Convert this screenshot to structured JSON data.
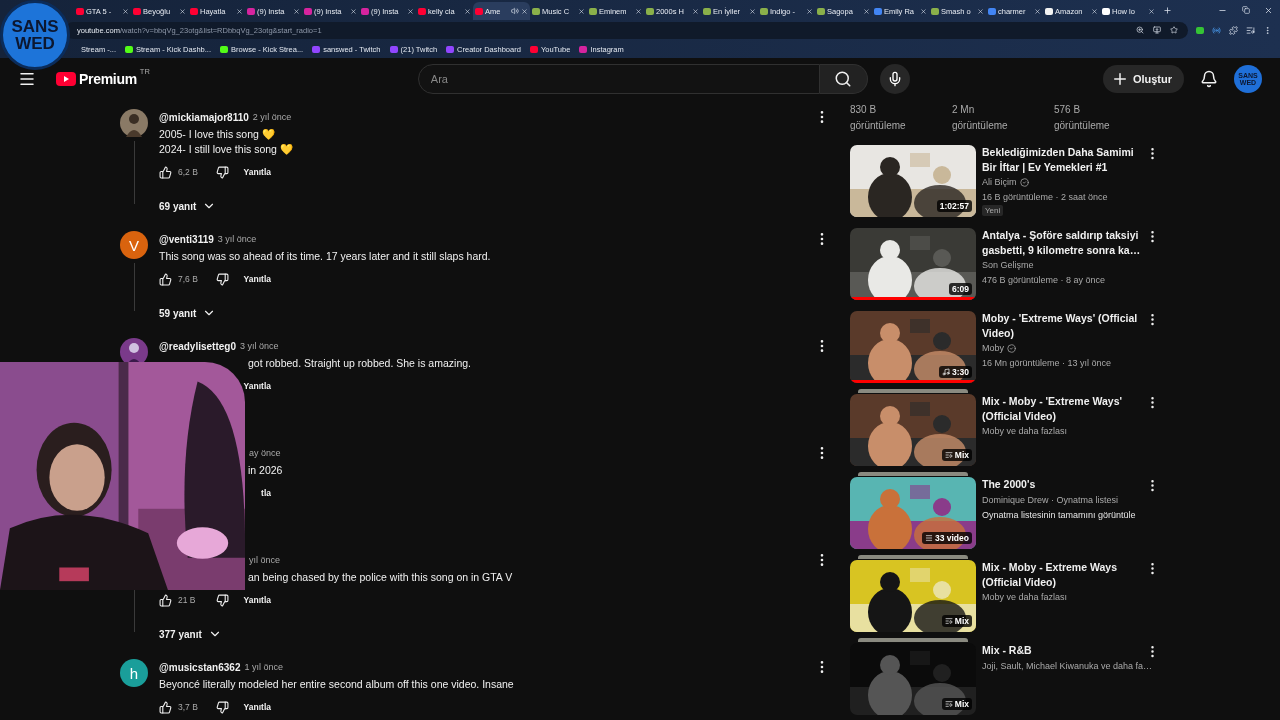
{
  "stream_logo": {
    "lines": [
      "SANS",
      "WED"
    ]
  },
  "browser": {
    "tabs": [
      {
        "title": "GTA 5 -",
        "kind": "play",
        "selected": false,
        "audio": false
      },
      {
        "title": "Beyoğlu",
        "kind": "play",
        "selected": false,
        "audio": false
      },
      {
        "title": "Hayatla",
        "kind": "play",
        "selected": false,
        "audio": false
      },
      {
        "title": "(9) Insta",
        "kind": "camera",
        "selected": false,
        "audio": false
      },
      {
        "title": "(9) Insta",
        "kind": "camera",
        "selected": false,
        "audio": false
      },
      {
        "title": "(9) Insta",
        "kind": "camera",
        "selected": false,
        "audio": false
      },
      {
        "title": "kelly cla",
        "kind": "play",
        "selected": false,
        "audio": false
      },
      {
        "title": "Ame",
        "kind": "play",
        "selected": true,
        "audio": true
      },
      {
        "title": "Music C",
        "kind": "site",
        "selected": false,
        "audio": false
      },
      {
        "title": "Eminem",
        "kind": "site",
        "selected": false,
        "audio": false
      },
      {
        "title": "2000s H",
        "kind": "site",
        "selected": false,
        "audio": false
      },
      {
        "title": "En İyiler",
        "kind": "site",
        "selected": false,
        "audio": false
      },
      {
        "title": "Indigo -",
        "kind": "site",
        "selected": false,
        "audio": false
      },
      {
        "title": "Sagopa",
        "kind": "site",
        "selected": false,
        "audio": false
      },
      {
        "title": "Emily Ra",
        "kind": "circle",
        "selected": false,
        "audio": false
      },
      {
        "title": "Smash o",
        "kind": "site",
        "selected": false,
        "audio": false
      },
      {
        "title": "charmer",
        "kind": "circle",
        "selected": false,
        "audio": false
      },
      {
        "title": "Amazon",
        "kind": "square",
        "selected": false,
        "audio": false
      },
      {
        "title": "How lo",
        "kind": "page",
        "selected": false,
        "audio": false
      }
    ],
    "url": {
      "host": "youtube.com",
      "path": "/watch?v=bbqVg_23otg&list=RDbbqVg_23otg&start_radio=1"
    },
    "bookmarks": [
      {
        "label": "Stream -...",
        "kind": "none"
      },
      {
        "label": "Stream - Kick Dashb...",
        "kind": "kick"
      },
      {
        "label": "Browse - Kick Strea...",
        "kind": "kick"
      },
      {
        "label": "sanswed - Twitch",
        "kind": "twitch"
      },
      {
        "label": "(21) Twitch",
        "kind": "twitch"
      },
      {
        "label": "Creator Dashboard",
        "kind": "twitch"
      },
      {
        "label": "YouTube",
        "kind": "play"
      },
      {
        "label": "Instagram",
        "kind": "camera"
      }
    ]
  },
  "header": {
    "logo": "Premium",
    "region": "TR",
    "search": {
      "placeholder": "Ara"
    },
    "create": "Oluştur",
    "avatar": [
      "SANS",
      "WED"
    ]
  },
  "comments": [
    {
      "kind": "full",
      "user": "@mickiamajor8110",
      "time": "2 yıl önce",
      "text": "2005- I love this song 💛\n2024- I still love this song 💛",
      "likes": "6,2 B",
      "reply": "Yanıtla",
      "replies": "69 yanıt"
    },
    {
      "kind": "full",
      "avatar": {
        "kind": "letter",
        "letter": "V",
        "color": "#d9630e"
      },
      "user": "@venti3119",
      "time": "3 yıl önce",
      "text": "This song was so ahead of its time. 17 years later and it still slaps hard.",
      "likes": "7,6 B",
      "reply": "Yanıtla",
      "replies": "59 yanıt"
    },
    {
      "kind": "partial",
      "user": "@readylisetteg0",
      "time": "3 yıl önce",
      "text": "got robbed. Straight up robbed. She is amazing.",
      "reply": "Yanıtla"
    },
    {
      "kind": "partial",
      "time": "ay önce",
      "text": "in 2026",
      "reply": "tla"
    },
    {
      "kind": "partial",
      "time": "yıl önce",
      "text": "an being  chased by the police with this song on in GTA V",
      "likes": "21 B",
      "reply": "Yanıtla",
      "replies": "377 yanıt"
    },
    {
      "kind": "full",
      "avatar": {
        "kind": "letter",
        "letter": "h",
        "color": "#1a9e9a"
      },
      "user": "@musicstan6362",
      "time": "1 yıl önce",
      "text": "Beyoncé literally modeled her entire second album off this one video. Insane",
      "likes": "3,7 B",
      "reply": "Yanıtla"
    }
  ],
  "shorts_stats": [
    {
      "count": "830 B",
      "label": "görüntüleme"
    },
    {
      "count": "2 Mn",
      "label": "görüntüleme"
    },
    {
      "count": "576 B",
      "label": "görüntüleme"
    }
  ],
  "videos": [
    {
      "kind": "video",
      "title": "Beklediğimizden Daha Samimi Bir İftar | Ev Yemekleri #1",
      "channel": "Ali Biçim",
      "verified": true,
      "meta": "16 B görüntüleme · 2 saat önce",
      "tag": "Yeni",
      "badge": {
        "kind": "plain",
        "text": "1:02:57"
      }
    },
    {
      "kind": "video",
      "title": "Antalya - Şoföre saldırıp taksiyi gasbetti, 9 kilometre sonra ka…",
      "channel": "Son Gelişme",
      "verified": false,
      "meta": "476 B görüntüleme · 8 ay önce",
      "badge": {
        "kind": "plain",
        "text": "6:09"
      },
      "level": 1
    },
    {
      "kind": "video",
      "title": "Moby - 'Extreme Ways' (Official Video)",
      "channel": "Moby",
      "verified": true,
      "meta": "16 Mn görüntüleme · 13 yıl önce",
      "badge": {
        "kind": "music",
        "text": "3:30"
      },
      "level": 1
    },
    {
      "kind": "mix",
      "title": "Mix - Moby - 'Extreme Ways' (Official Video)",
      "channel": "Moby ve daha fazlası",
      "verified": false,
      "badge": {
        "kind": "mix",
        "text": "Mix"
      }
    },
    {
      "kind": "playlist",
      "title": "The 2000's",
      "channel": "Dominique Drew · Oynatma listesi",
      "verified": false,
      "link": "Oynatma listesinin tamamını görüntüle",
      "badge": {
        "kind": "list",
        "text": "33 video"
      }
    },
    {
      "kind": "mix",
      "title": "Mix - Moby - Extreme Ways (Official Video)",
      "channel": "Moby ve daha fazlası",
      "verified": false,
      "badge": {
        "kind": "mix",
        "text": "Mix"
      }
    },
    {
      "kind": "mix",
      "title": "Mix - R&B",
      "channel": "Joji, Sault, Michael Kiwanuka ve daha fa…",
      "verified": false,
      "badge": {
        "kind": "mix",
        "text": "Mix"
      }
    }
  ]
}
